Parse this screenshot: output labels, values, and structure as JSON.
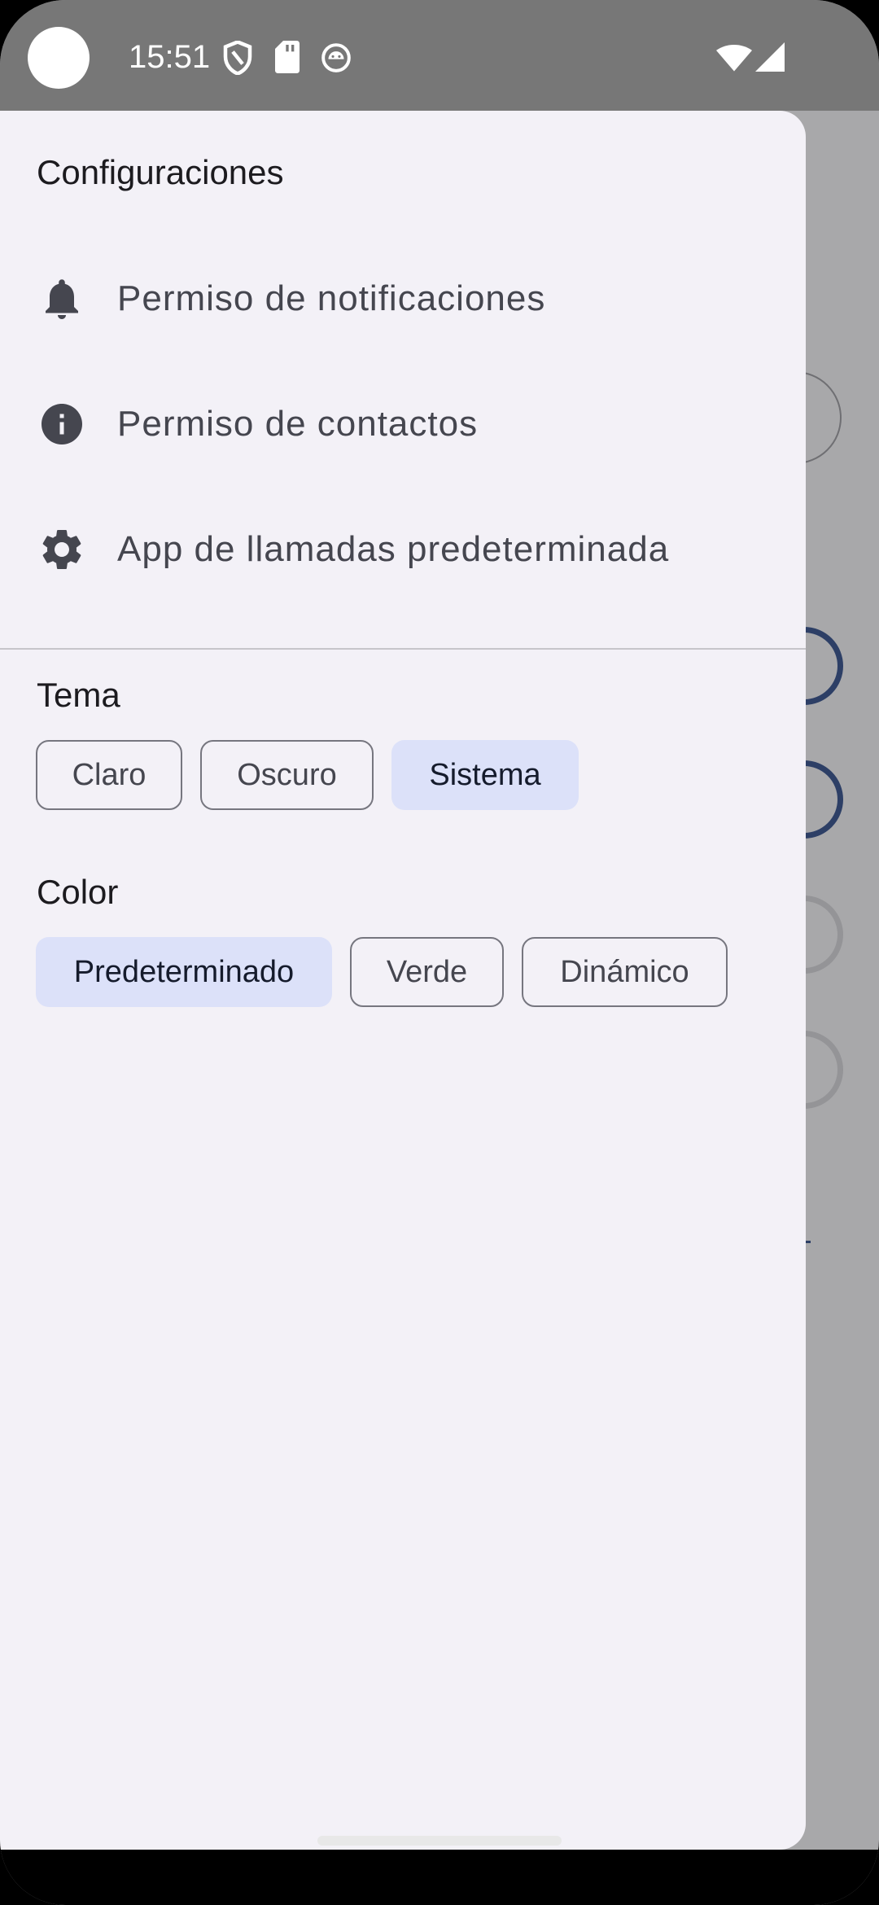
{
  "status_bar": {
    "time": "15:51",
    "icons": [
      "shield-icon",
      "sd-card-icon",
      "android-icon",
      "wifi-icon",
      "signal-icon"
    ]
  },
  "drawer": {
    "title": "Configuraciones",
    "items": [
      {
        "icon": "bell-icon",
        "label": "Permiso de notificaciones"
      },
      {
        "icon": "info-icon",
        "label": "Permiso de contactos"
      },
      {
        "icon": "gear-icon",
        "label": "App de llamadas predeterminada"
      }
    ],
    "theme": {
      "label": "Tema",
      "options": [
        "Claro",
        "Oscuro",
        "Sistema"
      ],
      "selected": "Sistema"
    },
    "color": {
      "label": "Color",
      "options": [
        "Predeterminado",
        "Verde",
        "Dinámico"
      ],
      "selected": "Predeterminado"
    }
  },
  "colors": {
    "drawer_bg": "#f3f1f7",
    "chip_selected_bg": "#dce1f9",
    "scrim": "#a8a8aa",
    "status_bar": "#777777"
  }
}
